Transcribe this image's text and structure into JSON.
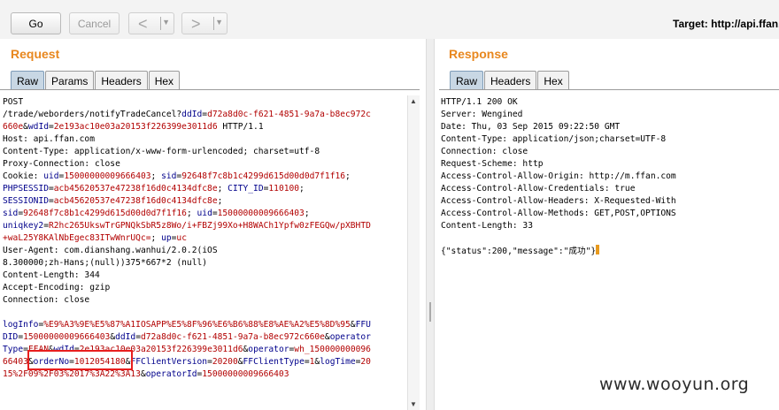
{
  "toolbar": {
    "go_label": "Go",
    "cancel_label": "Cancel",
    "back_arrow": "<",
    "forward_arrow": ">",
    "dropdown_caret": "▼",
    "target_text": "Target: http://api.ffan.com"
  },
  "request": {
    "title": "Request",
    "tabs": [
      "Raw",
      "Params",
      "Headers",
      "Hex"
    ],
    "lines": [
      {
        "segments": [
          {
            "t": "POST",
            "c": ""
          }
        ]
      },
      {
        "segments": [
          {
            "t": "/trade/weborders/notifyTradeCancel?",
            "c": ""
          },
          {
            "t": "ddId",
            "c": "blue"
          },
          {
            "t": "=",
            "c": ""
          },
          {
            "t": "d72a8d0c-f621-4851-9a7a-b8ec972c",
            "c": "red"
          }
        ]
      },
      {
        "segments": [
          {
            "t": "660e",
            "c": "red"
          },
          {
            "t": "&",
            "c": ""
          },
          {
            "t": "wdId",
            "c": "blue"
          },
          {
            "t": "=",
            "c": ""
          },
          {
            "t": "2e193ac10e03a20153f226399e3011d6",
            "c": "red"
          },
          {
            "t": " HTTP/1.1",
            "c": ""
          }
        ]
      },
      {
        "segments": [
          {
            "t": "Host: api.ffan.com",
            "c": ""
          }
        ]
      },
      {
        "segments": [
          {
            "t": "Content-Type: application/x-www-form-urlencoded; charset=utf-8",
            "c": ""
          }
        ]
      },
      {
        "segments": [
          {
            "t": "Proxy-Connection: close",
            "c": ""
          }
        ]
      },
      {
        "segments": [
          {
            "t": "Cookie: ",
            "c": ""
          },
          {
            "t": "uid",
            "c": "blue"
          },
          {
            "t": "=",
            "c": ""
          },
          {
            "t": "15000000009666403",
            "c": "red"
          },
          {
            "t": "; ",
            "c": ""
          },
          {
            "t": "sid",
            "c": "blue"
          },
          {
            "t": "=",
            "c": ""
          },
          {
            "t": "92648f7c8b1c4299d615d00d0d7f1f16",
            "c": "red"
          },
          {
            "t": ";",
            "c": ""
          }
        ]
      },
      {
        "segments": [
          {
            "t": "PHPSESSID",
            "c": "blue"
          },
          {
            "t": "=",
            "c": ""
          },
          {
            "t": "acb45620537e47238f16d0c4134dfc8e",
            "c": "red"
          },
          {
            "t": "; ",
            "c": ""
          },
          {
            "t": "CITY_ID",
            "c": "blue"
          },
          {
            "t": "=",
            "c": ""
          },
          {
            "t": "110100",
            "c": "red"
          },
          {
            "t": ";",
            "c": ""
          }
        ]
      },
      {
        "segments": [
          {
            "t": "SESSIONID",
            "c": "blue"
          },
          {
            "t": "=",
            "c": ""
          },
          {
            "t": "acb45620537e47238f16d0c4134dfc8e",
            "c": "red"
          },
          {
            "t": ";",
            "c": ""
          }
        ]
      },
      {
        "segments": [
          {
            "t": "sid",
            "c": "blue"
          },
          {
            "t": "=",
            "c": ""
          },
          {
            "t": "92648f7c8b1c4299d615d00d0d7f1f16",
            "c": "red"
          },
          {
            "t": "; ",
            "c": ""
          },
          {
            "t": "uid",
            "c": "blue"
          },
          {
            "t": "=",
            "c": ""
          },
          {
            "t": "15000000009666403",
            "c": "red"
          },
          {
            "t": ";",
            "c": ""
          }
        ]
      },
      {
        "segments": [
          {
            "t": "uniqkey2",
            "c": "blue"
          },
          {
            "t": "=",
            "c": ""
          },
          {
            "t": "R2hc265UkswTrGPNQkSbR5z8Wo/i+FBZj99Xo+H8WACh1Ypfw0zFEGQw/pXBHTD",
            "c": "red"
          }
        ]
      },
      {
        "segments": [
          {
            "t": "+waL25Y8KAlNbEgec83ITwWnrUQc=",
            "c": "red"
          },
          {
            "t": "; ",
            "c": ""
          },
          {
            "t": "up",
            "c": "blue"
          },
          {
            "t": "=",
            "c": ""
          },
          {
            "t": "uc",
            "c": "red"
          }
        ]
      },
      {
        "segments": [
          {
            "t": "User-Agent: com.dianshang.wanhui/2.0.2(iOS",
            "c": ""
          }
        ]
      },
      {
        "segments": [
          {
            "t": "8.300000;zh-Hans;(null))375*667*2 (null)",
            "c": ""
          }
        ]
      },
      {
        "segments": [
          {
            "t": "Content-Length: 344",
            "c": ""
          }
        ]
      },
      {
        "segments": [
          {
            "t": "Accept-Encoding: gzip",
            "c": ""
          }
        ]
      },
      {
        "segments": [
          {
            "t": "Connection: close",
            "c": ""
          }
        ]
      },
      {
        "segments": [
          {
            "t": "",
            "c": ""
          }
        ]
      },
      {
        "segments": [
          {
            "t": "logInfo",
            "c": "blue"
          },
          {
            "t": "=",
            "c": ""
          },
          {
            "t": "%E9%A3%9E%E5%87%A1IOSAPP%E5%8F%96%E6%B6%88%E8%AE%A2%E5%8D%95",
            "c": "red"
          },
          {
            "t": "&",
            "c": ""
          },
          {
            "t": "FFU",
            "c": "blue"
          }
        ]
      },
      {
        "segments": [
          {
            "t": "DID",
            "c": "blue"
          },
          {
            "t": "=",
            "c": ""
          },
          {
            "t": "15000000009666403",
            "c": "red"
          },
          {
            "t": "&",
            "c": ""
          },
          {
            "t": "ddId",
            "c": "blue"
          },
          {
            "t": "=",
            "c": ""
          },
          {
            "t": "d72a8d0c-f621-4851-9a7a-b8ec972c660e",
            "c": "red"
          },
          {
            "t": "&",
            "c": ""
          },
          {
            "t": "operator",
            "c": "blue"
          }
        ]
      },
      {
        "segments": [
          {
            "t": "Type",
            "c": "blue"
          },
          {
            "t": "=",
            "c": ""
          },
          {
            "t": "FFAN",
            "c": "red"
          },
          {
            "t": "&",
            "c": ""
          },
          {
            "t": "wdId",
            "c": "blue"
          },
          {
            "t": "=",
            "c": ""
          },
          {
            "t": "2e193ac10e03a20153f226399e3011d6",
            "c": "red"
          },
          {
            "t": "&",
            "c": ""
          },
          {
            "t": "operator",
            "c": "blue"
          },
          {
            "t": "=",
            "c": ""
          },
          {
            "t": "wh_150000000096",
            "c": "red"
          }
        ]
      },
      {
        "segments": [
          {
            "t": "66403",
            "c": "red"
          },
          {
            "t": "&",
            "c": ""
          },
          {
            "t": "orderNo",
            "c": "blue"
          },
          {
            "t": "=",
            "c": ""
          },
          {
            "t": "1012054180",
            "c": "red"
          },
          {
            "t": "&",
            "c": ""
          },
          {
            "t": "FFClientVersion",
            "c": "blue"
          },
          {
            "t": "=",
            "c": ""
          },
          {
            "t": "20200",
            "c": "red"
          },
          {
            "t": "&",
            "c": ""
          },
          {
            "t": "FFClientType",
            "c": "blue"
          },
          {
            "t": "=",
            "c": ""
          },
          {
            "t": "1",
            "c": "red"
          },
          {
            "t": "&",
            "c": ""
          },
          {
            "t": "logTime",
            "c": "blue"
          },
          {
            "t": "=",
            "c": ""
          },
          {
            "t": "20",
            "c": "red"
          }
        ]
      },
      {
        "segments": [
          {
            "t": "15%2F09%2F03%2017%3A22%3A13",
            "c": "red"
          },
          {
            "t": "&",
            "c": ""
          },
          {
            "t": "operatorId",
            "c": "blue"
          },
          {
            "t": "=",
            "c": ""
          },
          {
            "t": "15000000009666403",
            "c": "red"
          }
        ]
      }
    ]
  },
  "response": {
    "title": "Response",
    "tabs": [
      "Raw",
      "Headers",
      "Hex"
    ],
    "lines": [
      "HTTP/1.1 200 OK",
      "Server: Wengined",
      "Date: Thu, 03 Sep 2015 09:22:50 GMT",
      "Content-Type: application/json;charset=UTF-8",
      "Connection: close",
      "Request-Scheme: http",
      "Access-Control-Allow-Origin: http://m.ffan.com",
      "Access-Control-Allow-Credentials: true",
      "Access-Control-Allow-Headers: X-Requested-With",
      "Access-Control-Allow-Methods: GET,POST,OPTIONS",
      "Content-Length: 33",
      "",
      "{\"status\":200,\"message\":\"成功\"}"
    ]
  },
  "watermark": "www.wooyun.org",
  "colors": {
    "accent": "#e8871e",
    "param_name": "#00008b",
    "param_value": "#b20000",
    "highlight": "#e81e1e"
  }
}
